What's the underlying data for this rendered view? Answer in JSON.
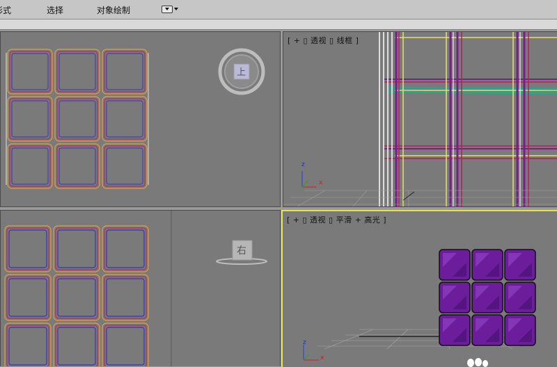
{
  "menubar": {
    "items": [
      "形式",
      "选择",
      "对象绘制"
    ]
  },
  "viewports": {
    "top": {
      "label": "",
      "nav_cube_label": "上"
    },
    "perspective_wire": {
      "label": "[ + ▯ 透视 ▯ 线框 ]"
    },
    "left": {
      "label": "",
      "nav_cube_label": "右"
    },
    "perspective_shaded": {
      "label": "[ + ▯ 透视 ▯ 平滑 + 高光 ]"
    }
  },
  "axis": {
    "x": "x",
    "z": "z"
  },
  "colors": {
    "viewport_bg": "#7a7a7a",
    "active_border": "#e6e34a",
    "cube_purple": "#6a1a9a"
  }
}
